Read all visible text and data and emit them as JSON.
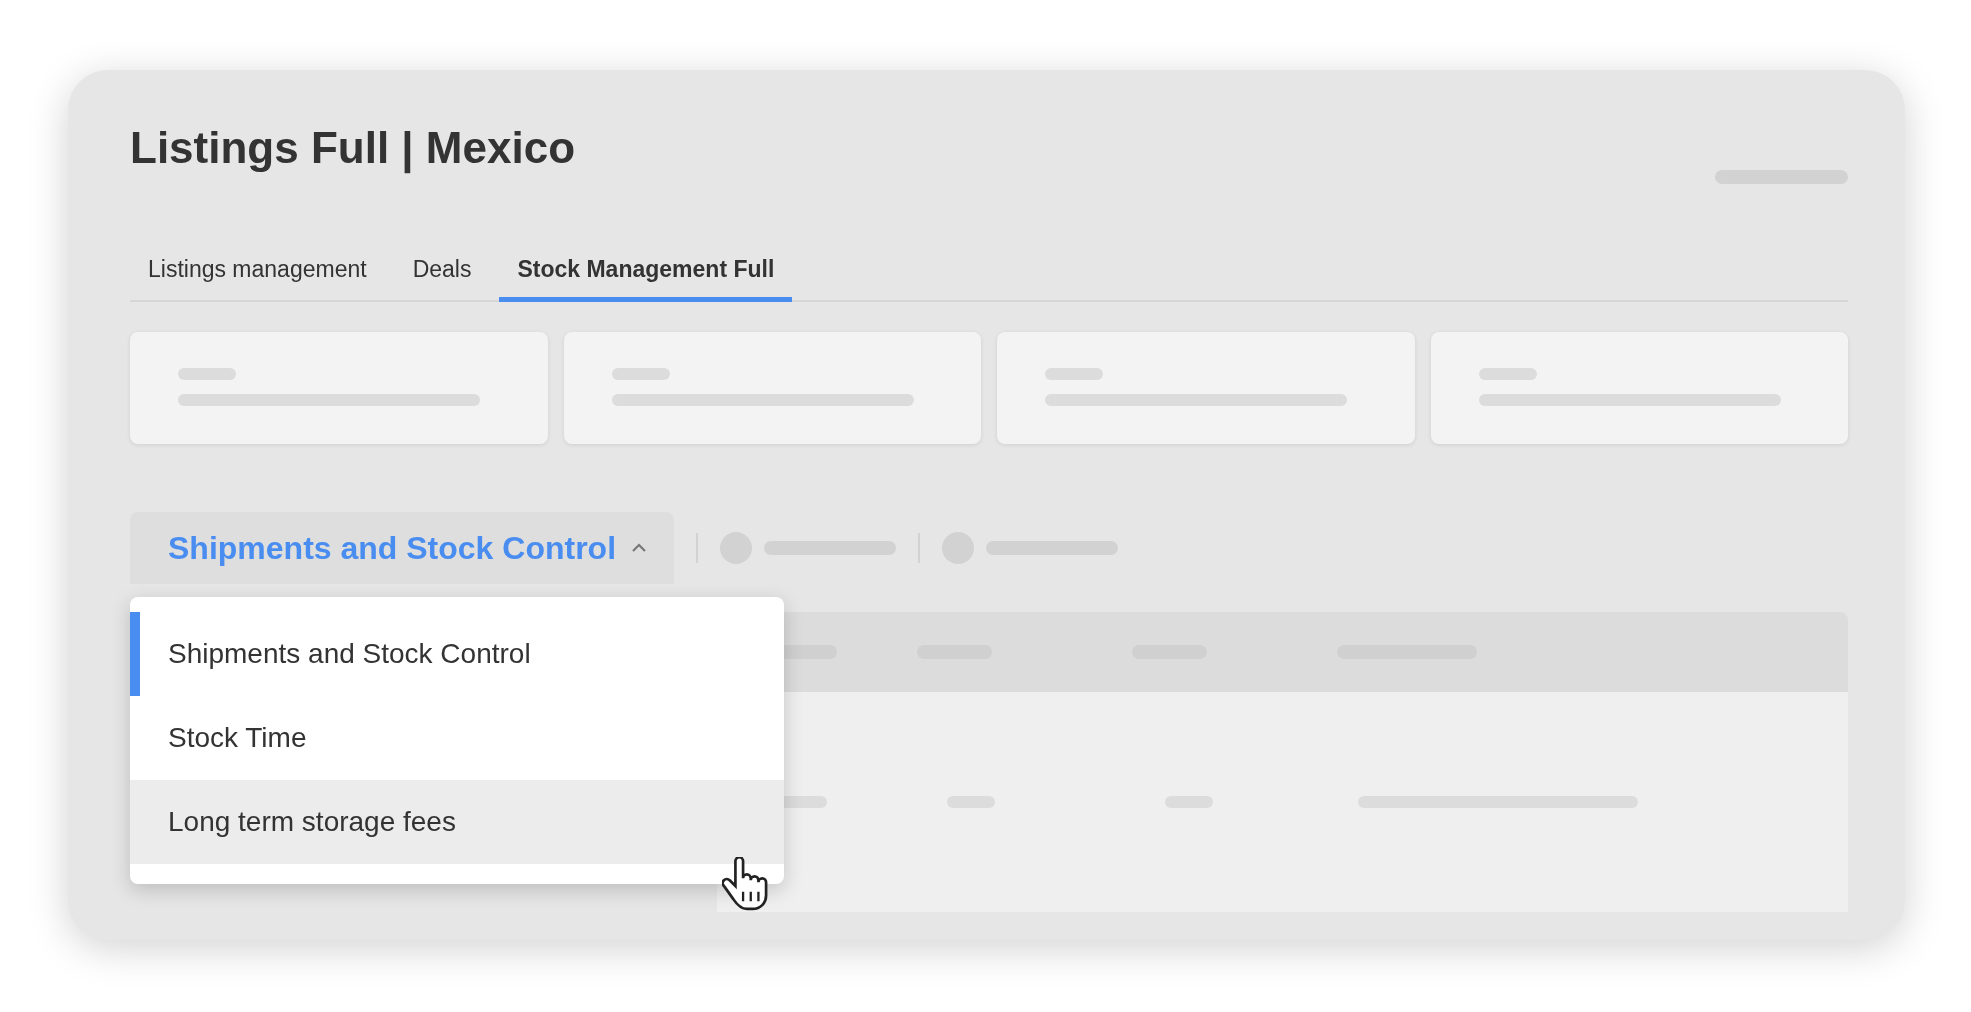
{
  "page": {
    "title": "Listings Full | Mexico"
  },
  "tabs": [
    {
      "label": "Listings management",
      "selected": false
    },
    {
      "label": "Deals",
      "selected": false
    },
    {
      "label": "Stock Management Full",
      "selected": true
    }
  ],
  "view_selector": {
    "label": "Shipments and Stock Control",
    "expanded": true
  },
  "menu": {
    "items": [
      {
        "label": "Shipments and Stock Control",
        "selected": true,
        "hovered": false
      },
      {
        "label": "Stock Time",
        "selected": false,
        "hovered": false
      },
      {
        "label": "Long term storage fees",
        "selected": false,
        "hovered": true
      }
    ]
  }
}
